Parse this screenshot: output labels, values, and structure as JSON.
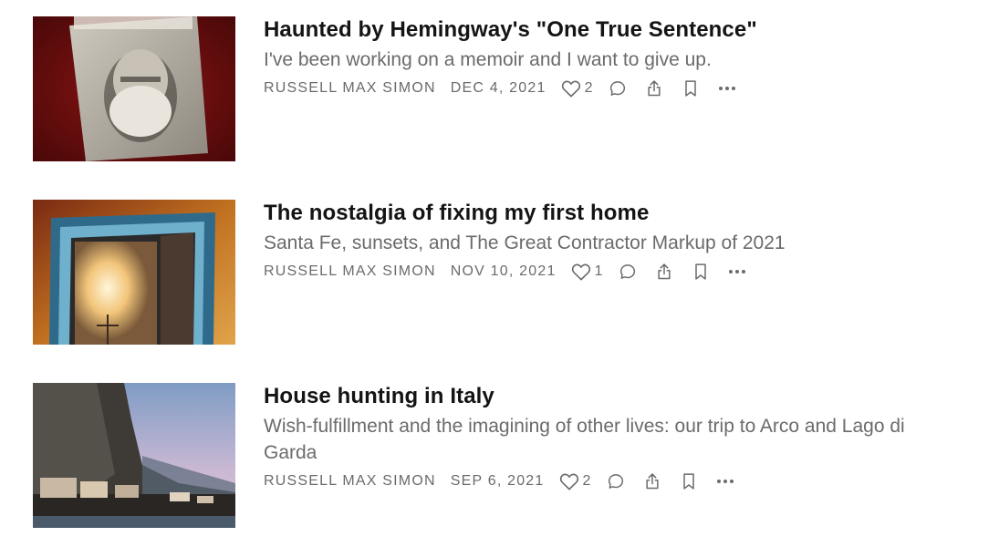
{
  "posts": [
    {
      "title": "Haunted by Hemingway's \"One True Sentence\"",
      "subtitle": "I've been working on a memoir and I want to give up.",
      "author": "RUSSELL MAX SIMON",
      "date": "DEC 4, 2021",
      "likes": "2",
      "thumbnail_icon": "hemingway-book-photo"
    },
    {
      "title": "The nostalgia of fixing my first home",
      "subtitle": "Santa Fe, sunsets, and The Great Contractor Markup of 2021",
      "author": "RUSSELL MAX SIMON",
      "date": "NOV 10, 2021",
      "likes": "1",
      "thumbnail_icon": "blue-window-photo"
    },
    {
      "title": "House hunting in Italy",
      "subtitle": "Wish-fulfillment and the imagining of other lives: our trip to Arco and Lago di Garda",
      "author": "RUSSELL MAX SIMON",
      "date": "SEP 6, 2021",
      "likes": "2",
      "thumbnail_icon": "italy-mountain-photo"
    }
  ],
  "colors": {
    "title": "#141414",
    "muted": "#6b6b6b",
    "background": "#ffffff"
  },
  "icons": [
    "heart-icon",
    "comment-icon",
    "share-icon",
    "bookmark-icon",
    "more-icon"
  ]
}
